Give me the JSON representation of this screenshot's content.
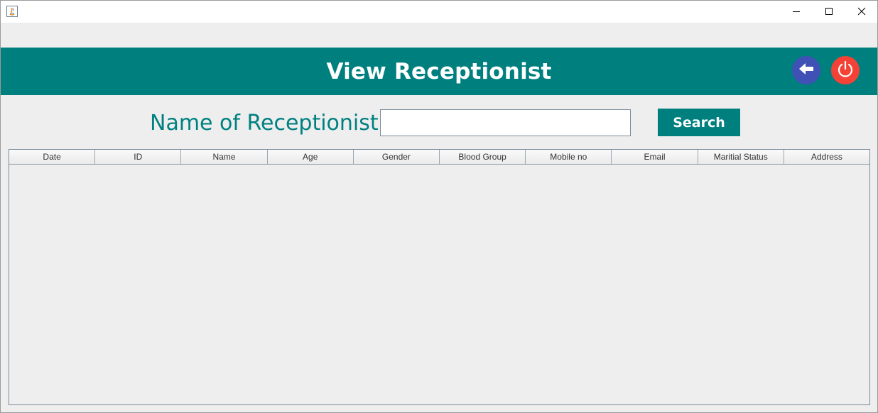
{
  "window": {
    "controls": {
      "minimize_icon": "minimize-icon",
      "maximize_icon": "maximize-icon",
      "close_icon": "close-icon"
    }
  },
  "header": {
    "title": "View Receptionist",
    "background_color": "#007f7f",
    "back_button_color": "#3f51b5",
    "power_button_color": "#f44336"
  },
  "search": {
    "label": "Name of Receptionist",
    "input_value": "",
    "button_label": "Search"
  },
  "table": {
    "columns": [
      "Date",
      "ID",
      "Name",
      "Age",
      "Gender",
      "Blood Group",
      "Mobile no",
      "Email",
      "Maritial Status",
      "Address"
    ],
    "rows": []
  }
}
